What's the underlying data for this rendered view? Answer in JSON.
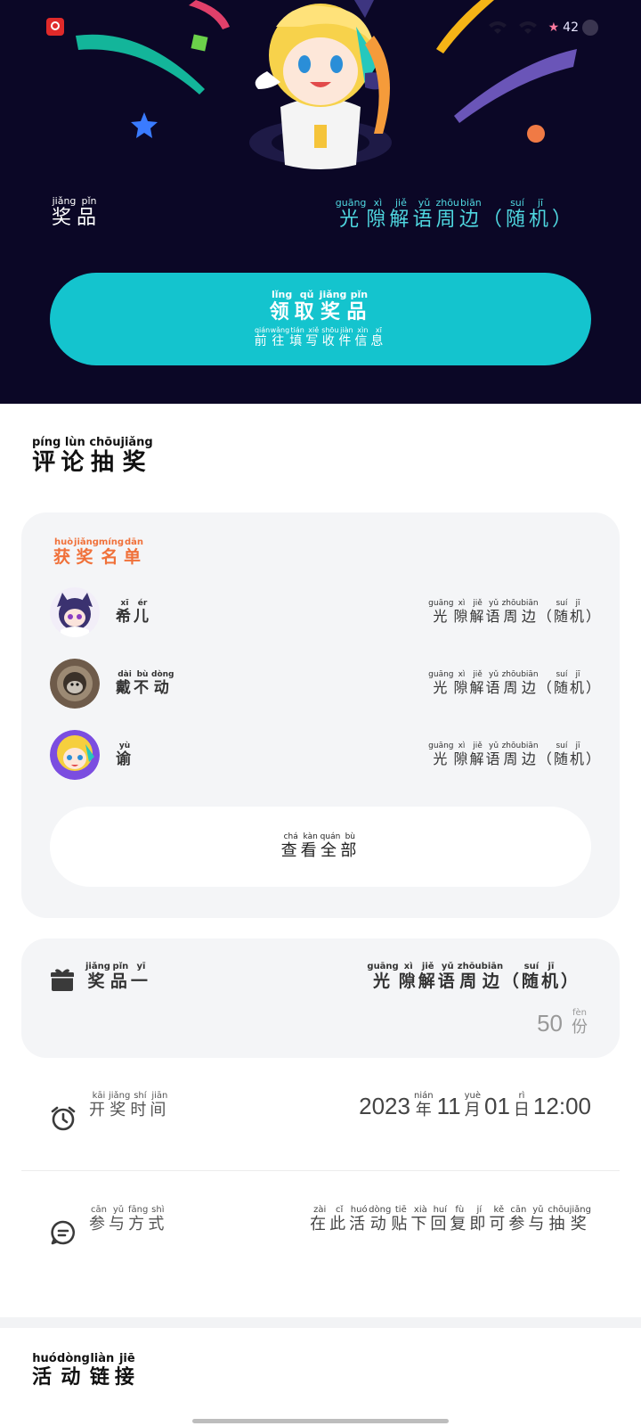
{
  "status_bar": {
    "time": "",
    "battery": "42"
  },
  "hero": {
    "prize_label": [
      [
        "奖",
        "jiǎng"
      ],
      [
        "品",
        "pǐn"
      ]
    ],
    "prize_name": [
      [
        "光",
        "guāng"
      ],
      [
        "隙",
        "xì"
      ],
      [
        "解",
        "jiě"
      ],
      [
        "语",
        "yǔ"
      ],
      [
        "周",
        "zhōu"
      ],
      [
        "边",
        "biān"
      ],
      [
        "（",
        ""
      ],
      [
        "随",
        "suí"
      ],
      [
        "机",
        "jī"
      ],
      [
        "）",
        ""
      ]
    ],
    "claim_button": {
      "title": [
        [
          "领",
          "lǐng"
        ],
        [
          "取",
          "qǔ"
        ],
        [
          "奖",
          "jiǎng"
        ],
        [
          "品",
          "pǐn"
        ]
      ],
      "subtitle": [
        [
          "前",
          "qián"
        ],
        [
          "往",
          "wǎng"
        ],
        [
          "填",
          "tián"
        ],
        [
          "写",
          "xiě"
        ],
        [
          "收",
          "shōu"
        ],
        [
          "件",
          "jiàn"
        ],
        [
          "信",
          "xìn"
        ],
        [
          "息",
          "xī"
        ]
      ]
    }
  },
  "comment_lottery": {
    "title": [
      [
        "评",
        "píng"
      ],
      [
        "论",
        "lùn"
      ],
      [
        "抽",
        "chōu"
      ],
      [
        "奖",
        "jiǎng"
      ]
    ],
    "winners_title": [
      [
        "获",
        "huò"
      ],
      [
        "奖",
        "jiǎng"
      ],
      [
        "名",
        "míng"
      ],
      [
        "单",
        "dān"
      ]
    ],
    "winners": [
      {
        "name": [
          [
            "希",
            "xī"
          ],
          [
            "儿",
            "ér"
          ]
        ],
        "prize": [
          [
            "光",
            "guāng"
          ],
          [
            "隙",
            "xì"
          ],
          [
            "解",
            "jiě"
          ],
          [
            "语",
            "yǔ"
          ],
          [
            "周",
            "zhōu"
          ],
          [
            "边",
            "biān"
          ],
          [
            "（",
            ""
          ],
          [
            "随",
            "suí"
          ],
          [
            "机",
            "jī"
          ],
          [
            "）",
            ""
          ]
        ]
      },
      {
        "name": [
          [
            "戴",
            "dài"
          ],
          [
            "不",
            "bù"
          ],
          [
            "动",
            "dòng"
          ]
        ],
        "prize": [
          [
            "光",
            "guāng"
          ],
          [
            "隙",
            "xì"
          ],
          [
            "解",
            "jiě"
          ],
          [
            "语",
            "yǔ"
          ],
          [
            "周",
            "zhōu"
          ],
          [
            "边",
            "biān"
          ],
          [
            "（",
            ""
          ],
          [
            "随",
            "suí"
          ],
          [
            "机",
            "jī"
          ],
          [
            "）",
            ""
          ]
        ]
      },
      {
        "name": [
          [
            "谕",
            "yù"
          ]
        ],
        "prize": [
          [
            "光",
            "guāng"
          ],
          [
            "隙",
            "xì"
          ],
          [
            "解",
            "jiě"
          ],
          [
            "语",
            "yǔ"
          ],
          [
            "周",
            "zhōu"
          ],
          [
            "边",
            "biān"
          ],
          [
            "（",
            ""
          ],
          [
            "随",
            "suí"
          ],
          [
            "机",
            "jī"
          ],
          [
            "）",
            ""
          ]
        ]
      }
    ],
    "view_all": [
      [
        "查",
        "chá"
      ],
      [
        "看",
        "kàn"
      ],
      [
        "全",
        "quán"
      ],
      [
        "部",
        "bù"
      ]
    ],
    "prize_card": {
      "label": [
        [
          "奖",
          "jiǎng"
        ],
        [
          "品",
          "pǐn"
        ],
        [
          "一",
          "yī"
        ]
      ],
      "name": [
        [
          "光",
          "guāng"
        ],
        [
          "隙",
          "xì"
        ],
        [
          "解",
          "jiě"
        ],
        [
          "语",
          "yǔ"
        ],
        [
          "周",
          "zhōu"
        ],
        [
          "边",
          "biān"
        ],
        [
          "（",
          ""
        ],
        [
          "随",
          "suí"
        ],
        [
          "机",
          "jī"
        ],
        [
          "）",
          ""
        ]
      ],
      "count": "50",
      "unit": [
        [
          "份",
          "fèn"
        ]
      ]
    },
    "draw_time": {
      "label": [
        [
          "开",
          "kāi"
        ],
        [
          "奖",
          "jiǎng"
        ],
        [
          "时",
          "shí"
        ],
        [
          "间",
          "jiān"
        ]
      ],
      "value": [
        [
          "2023",
          ""
        ],
        [
          "年",
          "nián"
        ],
        [
          "11",
          ""
        ],
        [
          "月",
          "yuè"
        ],
        [
          "01",
          ""
        ],
        [
          "日",
          "rì"
        ],
        [
          "12:00",
          ""
        ]
      ]
    },
    "method": {
      "label": [
        [
          "参",
          "cān"
        ],
        [
          "与",
          "yǔ"
        ],
        [
          "方",
          "fāng"
        ],
        [
          "式",
          "shì"
        ]
      ],
      "value": [
        [
          "在",
          "zài"
        ],
        [
          "此",
          "cǐ"
        ],
        [
          "活",
          "huó"
        ],
        [
          "动",
          "dòng"
        ],
        [
          "贴",
          "tiē"
        ],
        [
          "下",
          "xià"
        ],
        [
          "回",
          "huí"
        ],
        [
          "复",
          "fù"
        ],
        [
          "即",
          "jí"
        ],
        [
          "可",
          "kě"
        ],
        [
          "参",
          "cān"
        ],
        [
          "与",
          "yǔ"
        ],
        [
          "抽",
          "chōu"
        ],
        [
          "奖",
          "jiǎng"
        ]
      ]
    }
  },
  "activity_link": {
    "title": [
      [
        "活",
        "huó"
      ],
      [
        "动",
        "dòng"
      ],
      [
        "链",
        "liàn"
      ],
      [
        "接",
        "jiē"
      ]
    ]
  },
  "colors": {
    "hero_bg": "#0b0726",
    "accent_cyan": "#14c4ce",
    "prize_text": "#4fd7e0",
    "winners_orange": "#f0713a",
    "card_bg": "#f4f5f7"
  },
  "icons": [
    "alarm-clock-icon",
    "comment-icon",
    "gift-icon",
    "wifi-icon",
    "signal-icon",
    "battery-icon"
  ]
}
